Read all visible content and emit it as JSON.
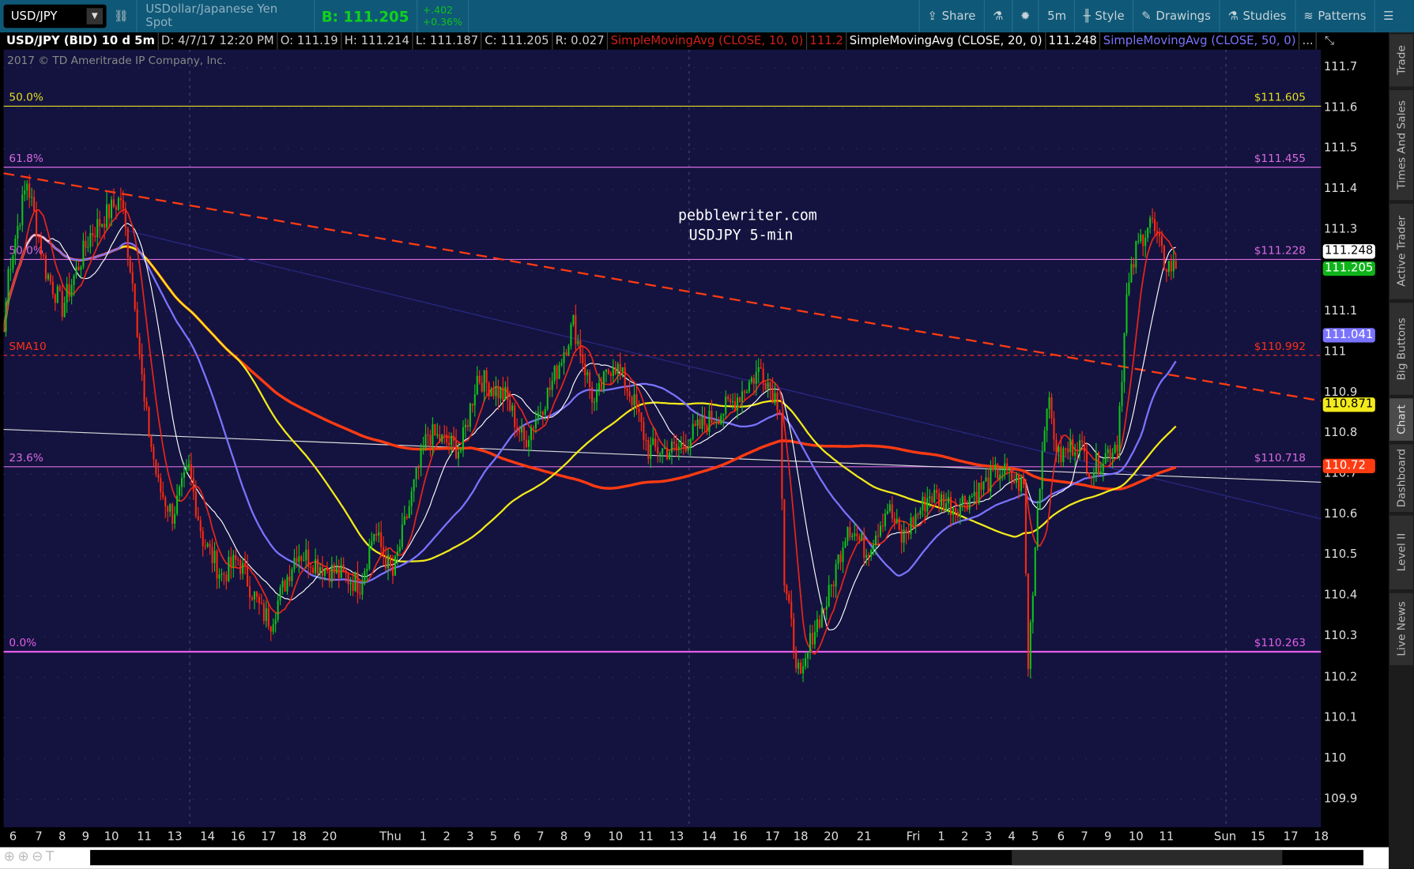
{
  "toolbar": {
    "symbol": "USD/JPY",
    "description": "USDollar/Japanese Yen Spot",
    "bid": "B: 111.205",
    "change": "+.402",
    "change_pct": "+0.36%",
    "share": "Share",
    "interval": "5m",
    "style": "Style",
    "drawings": "Drawings",
    "studies": "Studies",
    "patterns": "Patterns"
  },
  "legend": {
    "title": "USD/JPY (BID) 10 d 5m",
    "date": "D: 4/7/17 12:20 PM",
    "open": "O: 111.19",
    "high": "H: 111.214",
    "low": "L: 111.187",
    "close": "C: 111.205",
    "range": "R: 0.027",
    "sma10": "SimpleMovingAvg (CLOSE, 10, 0)",
    "sma10_val": "111.2",
    "sma20": "SimpleMovingAvg (CLOSE, 20, 0)",
    "sma20_val": "111.248",
    "sma50": "SimpleMovingAvg (CLOSE, 50, 0)",
    "more": "..."
  },
  "copyright": "2017 © TD Ameritrade IP Company, Inc.",
  "watermark": [
    "pebblewriter.com",
    "USDJPY 5-min"
  ],
  "side_tabs": [
    "Trade",
    "Times And Sales",
    "Active Trader",
    "Big Buttons",
    "Chart",
    "Dashboard",
    "Level II",
    "Live News"
  ],
  "chart_data": {
    "type": "candlestick",
    "title": "USD/JPY (BID) 10 d 5m",
    "ylim": [
      109.86,
      111.74
    ],
    "y_ticks": [
      "111.7",
      "111.6",
      "111.5",
      "111.4",
      "111.3",
      "111.2",
      "111.1",
      "111",
      "110.9",
      "110.8",
      "110.7",
      "110.6",
      "110.5",
      "110.4",
      "110.3",
      "110.2",
      "110.1",
      "110",
      "109.9"
    ],
    "x_ticks": [
      [
        4,
        "6"
      ],
      [
        15,
        "7"
      ],
      [
        25,
        "8"
      ],
      [
        35,
        "9"
      ],
      [
        46,
        "10"
      ],
      [
        60,
        "11"
      ],
      [
        73,
        "13"
      ],
      [
        87,
        "14"
      ],
      [
        100,
        "16"
      ],
      [
        113,
        "17"
      ],
      [
        126,
        "18"
      ],
      [
        139,
        "20"
      ],
      [
        165,
        "Thu"
      ],
      [
        179,
        "1"
      ],
      [
        189,
        "2"
      ],
      [
        199,
        "3"
      ],
      [
        209,
        "5"
      ],
      [
        219,
        "6"
      ],
      [
        229,
        "7"
      ],
      [
        239,
        "8"
      ],
      [
        249,
        "9"
      ],
      [
        261,
        "10"
      ],
      [
        274,
        "11"
      ],
      [
        287,
        "13"
      ],
      [
        301,
        "14"
      ],
      [
        314,
        "16"
      ],
      [
        328,
        "17"
      ],
      [
        340,
        "18"
      ],
      [
        353,
        "20"
      ],
      [
        367,
        "21"
      ],
      [
        388,
        "Fri"
      ],
      [
        400,
        "1"
      ],
      [
        410,
        "2"
      ],
      [
        420,
        "3"
      ],
      [
        430,
        "4"
      ],
      [
        440,
        "5"
      ],
      [
        451,
        "6"
      ],
      [
        461,
        "7"
      ],
      [
        471,
        "9"
      ],
      [
        483,
        "10"
      ],
      [
        496,
        "11"
      ],
      [
        521,
        "Sun"
      ],
      [
        535,
        "15"
      ],
      [
        549,
        "17"
      ],
      [
        562,
        "18"
      ]
    ],
    "close_path": [
      [
        0,
        111.05
      ],
      [
        2,
        111.2
      ],
      [
        10,
        111.42
      ],
      [
        18,
        111.2
      ],
      [
        25,
        111.11
      ],
      [
        37,
        111.29
      ],
      [
        50,
        111.38
      ],
      [
        56,
        111.13
      ],
      [
        60,
        110.87
      ],
      [
        66,
        110.67
      ],
      [
        72,
        110.6
      ],
      [
        79,
        110.71
      ],
      [
        85,
        110.54
      ],
      [
        93,
        110.45
      ],
      [
        100,
        110.49
      ],
      [
        110,
        110.36
      ],
      [
        114,
        110.34
      ],
      [
        125,
        110.51
      ],
      [
        137,
        110.47
      ],
      [
        152,
        110.43
      ],
      [
        158,
        110.56
      ],
      [
        166,
        110.45
      ],
      [
        175,
        110.67
      ],
      [
        181,
        110.8
      ],
      [
        195,
        110.76
      ],
      [
        202,
        110.94
      ],
      [
        214,
        110.89
      ],
      [
        222,
        110.78
      ],
      [
        233,
        110.91
      ],
      [
        243,
        111.07
      ],
      [
        252,
        110.87
      ],
      [
        260,
        110.98
      ],
      [
        268,
        110.89
      ],
      [
        275,
        110.76
      ],
      [
        287,
        110.76
      ],
      [
        298,
        110.82
      ],
      [
        310,
        110.87
      ],
      [
        323,
        110.96
      ],
      [
        331,
        110.87
      ],
      [
        333,
        110.43
      ],
      [
        340,
        110.18
      ],
      [
        345,
        110.31
      ],
      [
        352,
        110.4
      ],
      [
        360,
        110.58
      ],
      [
        368,
        110.51
      ],
      [
        377,
        110.62
      ],
      [
        383,
        110.54
      ],
      [
        395,
        110.65
      ],
      [
        406,
        110.62
      ],
      [
        418,
        110.67
      ],
      [
        425,
        110.71
      ],
      [
        435,
        110.67
      ],
      [
        437,
        110.23
      ],
      [
        441,
        110.62
      ],
      [
        445,
        110.89
      ],
      [
        450,
        110.74
      ],
      [
        458,
        110.78
      ],
      [
        464,
        110.71
      ],
      [
        475,
        110.78
      ],
      [
        479,
        111.13
      ],
      [
        483,
        111.25
      ],
      [
        489,
        111.33
      ],
      [
        495,
        111.22
      ],
      [
        500,
        111.205
      ]
    ],
    "studies": [
      {
        "name": "SMA 10",
        "color": "#e8251a"
      },
      {
        "name": "SMA 20",
        "color": "#ffffff"
      },
      {
        "name": "SMA 50",
        "color": "#7a73ff"
      },
      {
        "name": "SMA 100",
        "color": "#f2ea1a"
      },
      {
        "name": "SMA 200",
        "color": "#ff3b12"
      }
    ],
    "levels": [
      {
        "label": "50.0%",
        "price": 111.605,
        "tag": "$111.605",
        "color": "#e3df1e"
      },
      {
        "label": "61.8%",
        "price": 111.455,
        "tag": "$111.455",
        "color": "#d86be0"
      },
      {
        "label": "50.0%",
        "price": 111.228,
        "tag": "$111.228",
        "color": "#d86be0"
      },
      {
        "label": "SMA10",
        "price": 110.992,
        "tag": "$110.992",
        "color": "#ff3018",
        "dashed": true
      },
      {
        "label": "23.6%",
        "price": 110.718,
        "tag": "$110.718",
        "color": "#d86be0"
      },
      {
        "label": "0.0%",
        "price": 110.263,
        "tag": "$110.263",
        "color": "#e05ee8"
      }
    ],
    "trendlines": [
      {
        "from": [
          0,
          111.44
        ],
        "to": [
          562,
          110.88
        ],
        "color": "#ff3b12",
        "dashed": true
      },
      {
        "from": [
          0,
          110.81
        ],
        "to": [
          562,
          110.68
        ],
        "color": "#dddddd"
      },
      {
        "from": [
          52,
          111.3
        ],
        "to": [
          562,
          110.59
        ],
        "color": "#2a2a8a"
      }
    ],
    "badges": [
      {
        "value": "111.248",
        "price": 111.248,
        "bg": "#ffffff",
        "fg": "#000"
      },
      {
        "value": "111.205",
        "price": 111.205,
        "bg": "#0fb41a",
        "fg": "#fff"
      },
      {
        "value": "111.041",
        "price": 111.041,
        "bg": "#7a73ff",
        "fg": "#fff"
      },
      {
        "value": "110.871",
        "price": 110.871,
        "bg": "#f2ea1a",
        "fg": "#000"
      },
      {
        "value": "110.72",
        "price": 110.72,
        "bg": "#ff3b12",
        "fg": "#fff"
      }
    ]
  }
}
